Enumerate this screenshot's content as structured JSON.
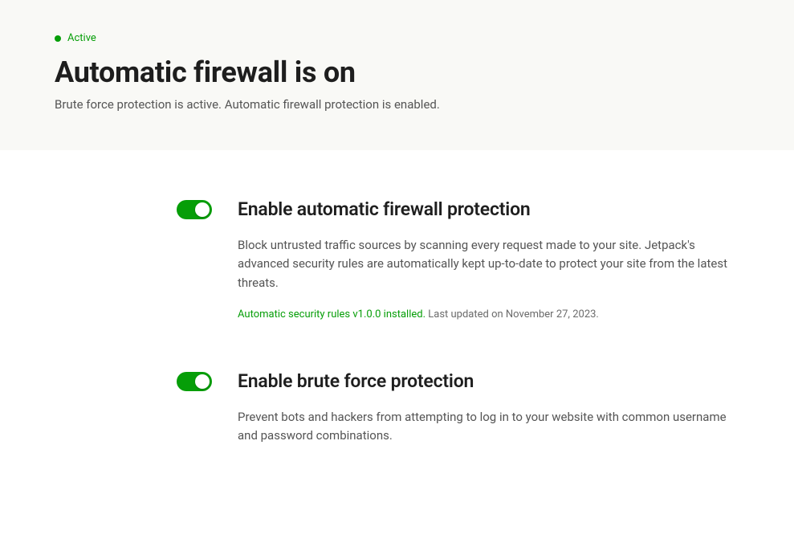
{
  "header": {
    "status_label": "Active",
    "title": "Automatic firewall is on",
    "subtitle": "Brute force protection is active. Automatic firewall protection is enabled."
  },
  "settings": {
    "firewall": {
      "title": "Enable automatic firewall protection",
      "description": "Block untrusted traffic sources by scanning every request made to your site. Jetpack's advanced security rules are automatically kept up-to-date to protect your site from the latest threats.",
      "meta_highlight": "Automatic security rules v1.0.0 installed.",
      "meta_rest": " Last updated on November 27, 2023."
    },
    "bruteforce": {
      "title": "Enable brute force protection",
      "description": "Prevent bots and hackers from attempting to log in to your website with common username and password combinations."
    }
  },
  "colors": {
    "accent": "#069e08"
  }
}
